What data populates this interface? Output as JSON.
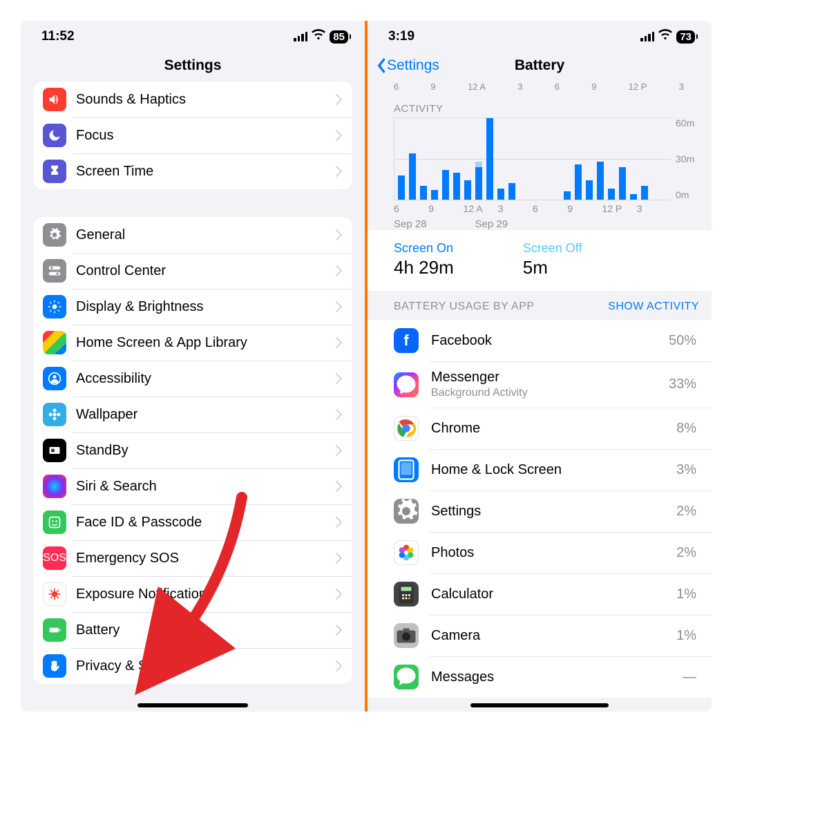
{
  "left": {
    "status": {
      "time": "11:52",
      "battery": "85"
    },
    "title": "Settings",
    "group1": [
      {
        "key": "sounds",
        "label": "Sounds & Haptics",
        "bg": "bg-red",
        "icon": "speaker-icon"
      },
      {
        "key": "focus",
        "label": "Focus",
        "bg": "bg-indigo",
        "icon": "moon-icon"
      },
      {
        "key": "screentime",
        "label": "Screen Time",
        "bg": "bg-indigo",
        "icon": "hourglass-icon"
      }
    ],
    "group2": [
      {
        "key": "general",
        "label": "General",
        "bg": "bg-grey",
        "icon": "gear-icon"
      },
      {
        "key": "control",
        "label": "Control Center",
        "bg": "bg-grey",
        "icon": "switches-icon"
      },
      {
        "key": "display",
        "label": "Display & Brightness",
        "bg": "bg-blue",
        "icon": "sun-icon"
      },
      {
        "key": "home",
        "label": "Home Screen & App Library",
        "bg": "bg-multi",
        "icon": "grid-icon"
      },
      {
        "key": "access",
        "label": "Accessibility",
        "bg": "bg-blue",
        "icon": "person-circle-icon"
      },
      {
        "key": "wallpaper",
        "label": "Wallpaper",
        "bg": "bg-teal",
        "icon": "flower-icon"
      },
      {
        "key": "standby",
        "label": "StandBy",
        "bg": "bg-black",
        "icon": "clock-card-icon"
      },
      {
        "key": "siri",
        "label": "Siri & Search",
        "bg": "bg-siri",
        "icon": "siri-icon"
      },
      {
        "key": "faceid",
        "label": "Face ID & Passcode",
        "bg": "bg-green",
        "icon": "face-icon"
      },
      {
        "key": "sos",
        "label": "Emergency SOS",
        "bg": "bg-orange",
        "icon": "sos-icon"
      },
      {
        "key": "exposure",
        "label": "Exposure Notifications",
        "bg": "bg-white",
        "icon": "virus-icon"
      },
      {
        "key": "battery",
        "label": "Battery",
        "bg": "bg-green",
        "icon": "battery-icon"
      },
      {
        "key": "privacy",
        "label": "Privacy & Security",
        "bg": "bg-blue",
        "icon": "hand-icon"
      }
    ]
  },
  "right": {
    "status": {
      "time": "3:19",
      "battery": "73"
    },
    "back": "Settings",
    "title": "Battery",
    "topTicks": [
      "6",
      "9",
      "12 A",
      "3",
      "6",
      "9",
      "12 P",
      "3"
    ],
    "activityLabel": "ACTIVITY",
    "yTicks": [
      "60m",
      "30m",
      "0m"
    ],
    "xTicks": [
      "6",
      "9",
      "12 A",
      "3",
      "6",
      "9",
      "12 P",
      "3"
    ],
    "dates": [
      "Sep 28",
      "Sep 29"
    ],
    "screenOnLabel": "Screen On",
    "screenOnValue": "4h 29m",
    "screenOffLabel": "Screen Off",
    "screenOffValue": "5m",
    "usageHeader": "BATTERY USAGE BY APP",
    "showActivity": "SHOW ACTIVITY",
    "apps": [
      {
        "key": "facebook",
        "name": "Facebook",
        "sub": "",
        "pct": "50%",
        "ic": "ic-fb"
      },
      {
        "key": "messenger",
        "name": "Messenger",
        "sub": "Background Activity",
        "pct": "33%",
        "ic": "ic-msg"
      },
      {
        "key": "chrome",
        "name": "Chrome",
        "sub": "",
        "pct": "8%",
        "ic": "ic-chrome"
      },
      {
        "key": "homescreen",
        "name": "Home & Lock Screen",
        "sub": "",
        "pct": "3%",
        "ic": "ic-home"
      },
      {
        "key": "settings",
        "name": "Settings",
        "sub": "",
        "pct": "2%",
        "ic": "ic-settings"
      },
      {
        "key": "photos",
        "name": "Photos",
        "sub": "",
        "pct": "2%",
        "ic": "ic-photos"
      },
      {
        "key": "calculator",
        "name": "Calculator",
        "sub": "",
        "pct": "1%",
        "ic": "ic-calc"
      },
      {
        "key": "camera",
        "name": "Camera",
        "sub": "",
        "pct": "1%",
        "ic": "ic-camera"
      },
      {
        "key": "messages",
        "name": "Messages",
        "sub": "",
        "pct": "—",
        "ic": "ic-messages"
      }
    ]
  },
  "chart_data": {
    "type": "bar",
    "title": "ACTIVITY",
    "ylabel": "minutes",
    "ylim": [
      0,
      60
    ],
    "yTicks": [
      0,
      30,
      60
    ],
    "categories": [
      "4",
      "5",
      "6",
      "7",
      "8",
      "9",
      "10",
      "11",
      "12A",
      "1",
      "2",
      "3",
      "4",
      "5",
      "6",
      "7",
      "8",
      "9",
      "10",
      "11",
      "12P",
      "1",
      "2",
      "3"
    ],
    "values": [
      18,
      34,
      10,
      7,
      22,
      20,
      14,
      24,
      60,
      8,
      12,
      0,
      0,
      0,
      0,
      6,
      26,
      14,
      28,
      8,
      24,
      4,
      10,
      0
    ],
    "light_overlay_index": 7,
    "dates": [
      "Sep 28",
      "Sep 29"
    ]
  }
}
